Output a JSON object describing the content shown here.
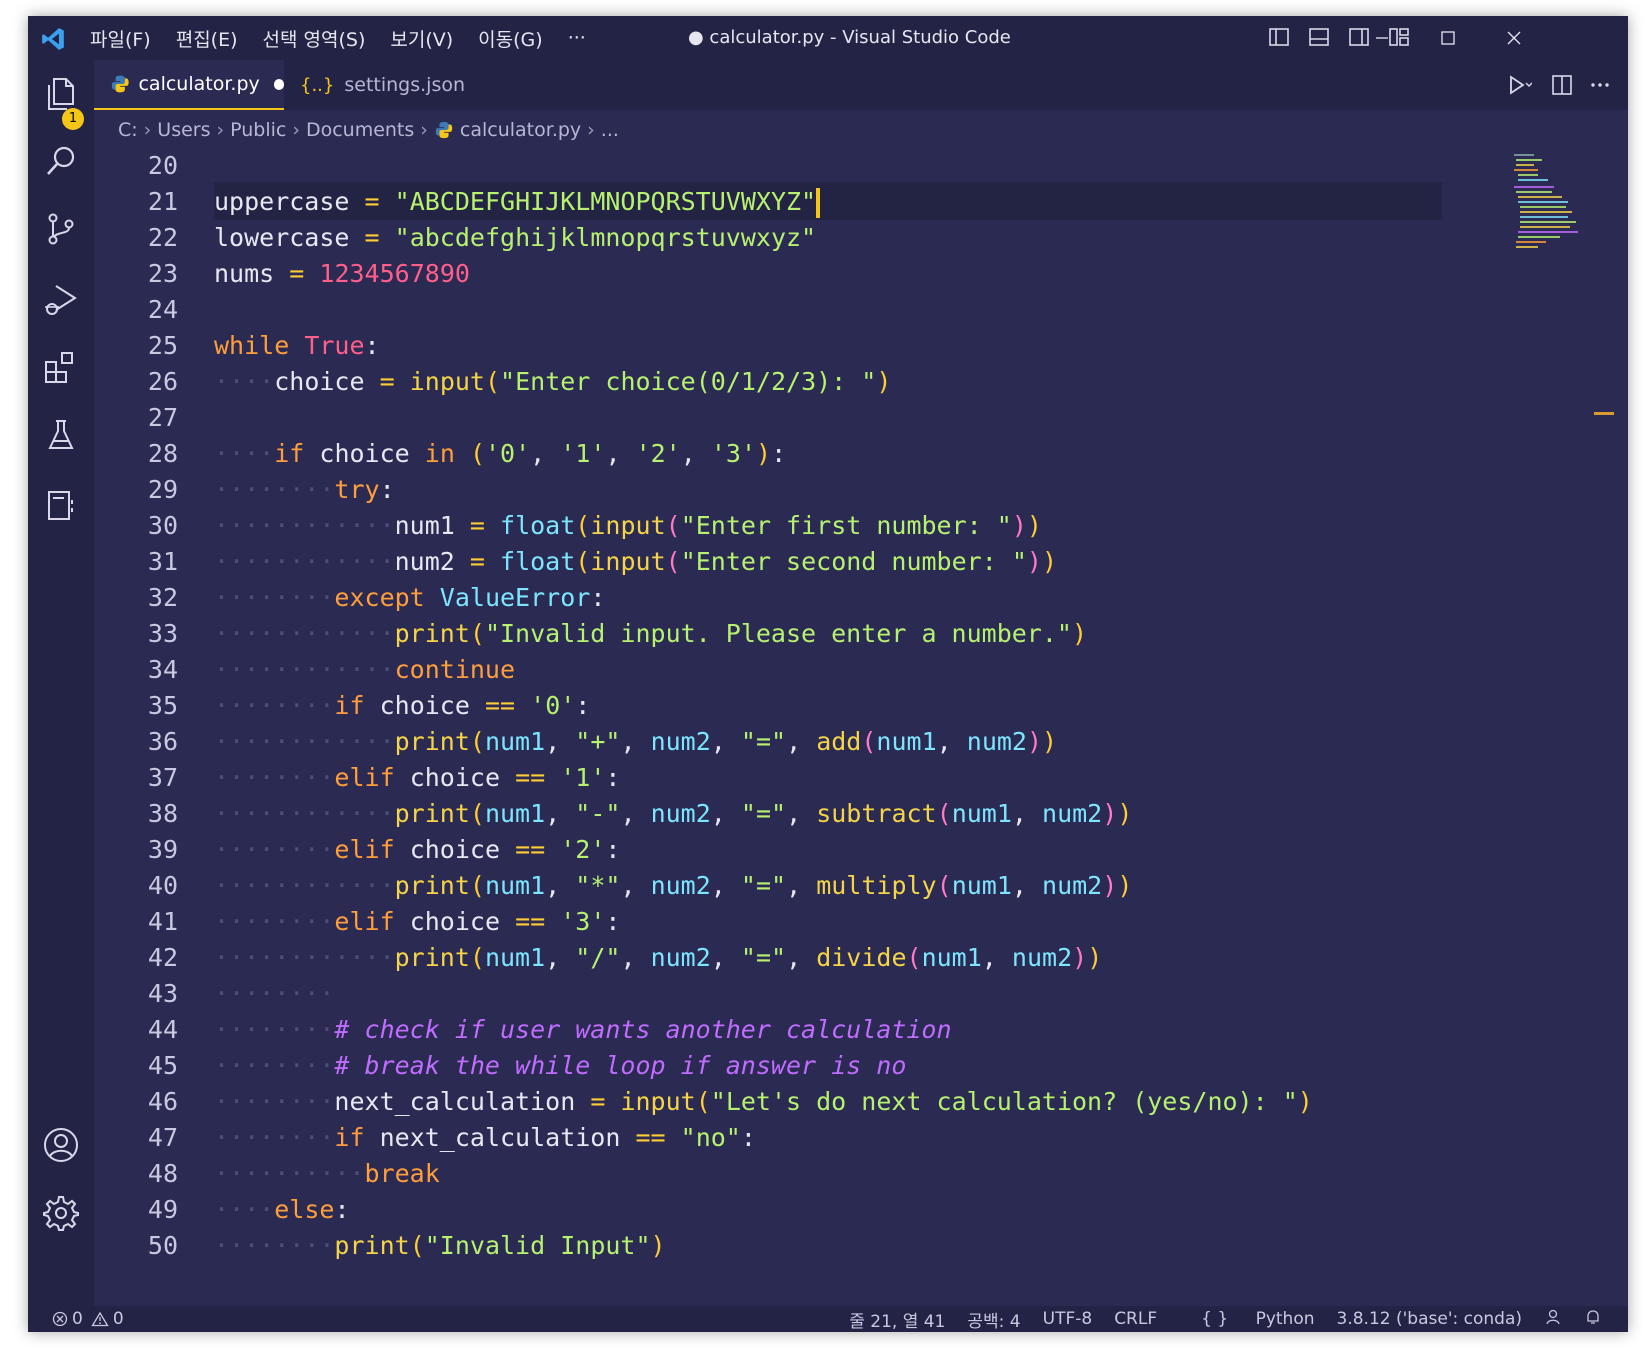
{
  "window": {
    "title": "● calculator.py - Visual Studio Code",
    "menus": [
      "파일(F)",
      "편집(E)",
      "선택 영역(S)",
      "보기(V)",
      "이동(G)",
      "···"
    ]
  },
  "activity": {
    "explorer_badge": "1"
  },
  "tabs": [
    {
      "label": "calculator.py",
      "active": true,
      "modified": true
    },
    {
      "label": "settings.json",
      "active": false
    }
  ],
  "breadcrumb": [
    "C:",
    "Users",
    "Public",
    "Documents",
    "calculator.py",
    "..."
  ],
  "editor": {
    "line_numbers": [
      "20",
      "21",
      "22",
      "23",
      "24",
      "25",
      "26",
      "27",
      "28",
      "29",
      "30",
      "31",
      "32",
      "33",
      "34",
      "35",
      "36",
      "37",
      "38",
      "39",
      "40",
      "41",
      "42",
      "43",
      "44",
      "45",
      "46",
      "47",
      "48",
      "49",
      "50"
    ],
    "cursor_line": "21"
  },
  "status": {
    "errors": "0",
    "warnings": "0",
    "position": "줄 21, 열 41",
    "spaces": "공백: 4",
    "encoding": "UTF-8",
    "eol": "CRLF",
    "language": "Python",
    "interpreter": "3.8.12 ('base': conda)"
  },
  "colors": {
    "background": "#2a2a52",
    "chrome": "#232345",
    "accent": "#f5c518",
    "keyword": "#ff9e3b",
    "string": "#b6f26f",
    "number": "#ff5f8a",
    "function": "#f5d547",
    "variable": "#7ee5ff",
    "comment": "#c06cff"
  }
}
